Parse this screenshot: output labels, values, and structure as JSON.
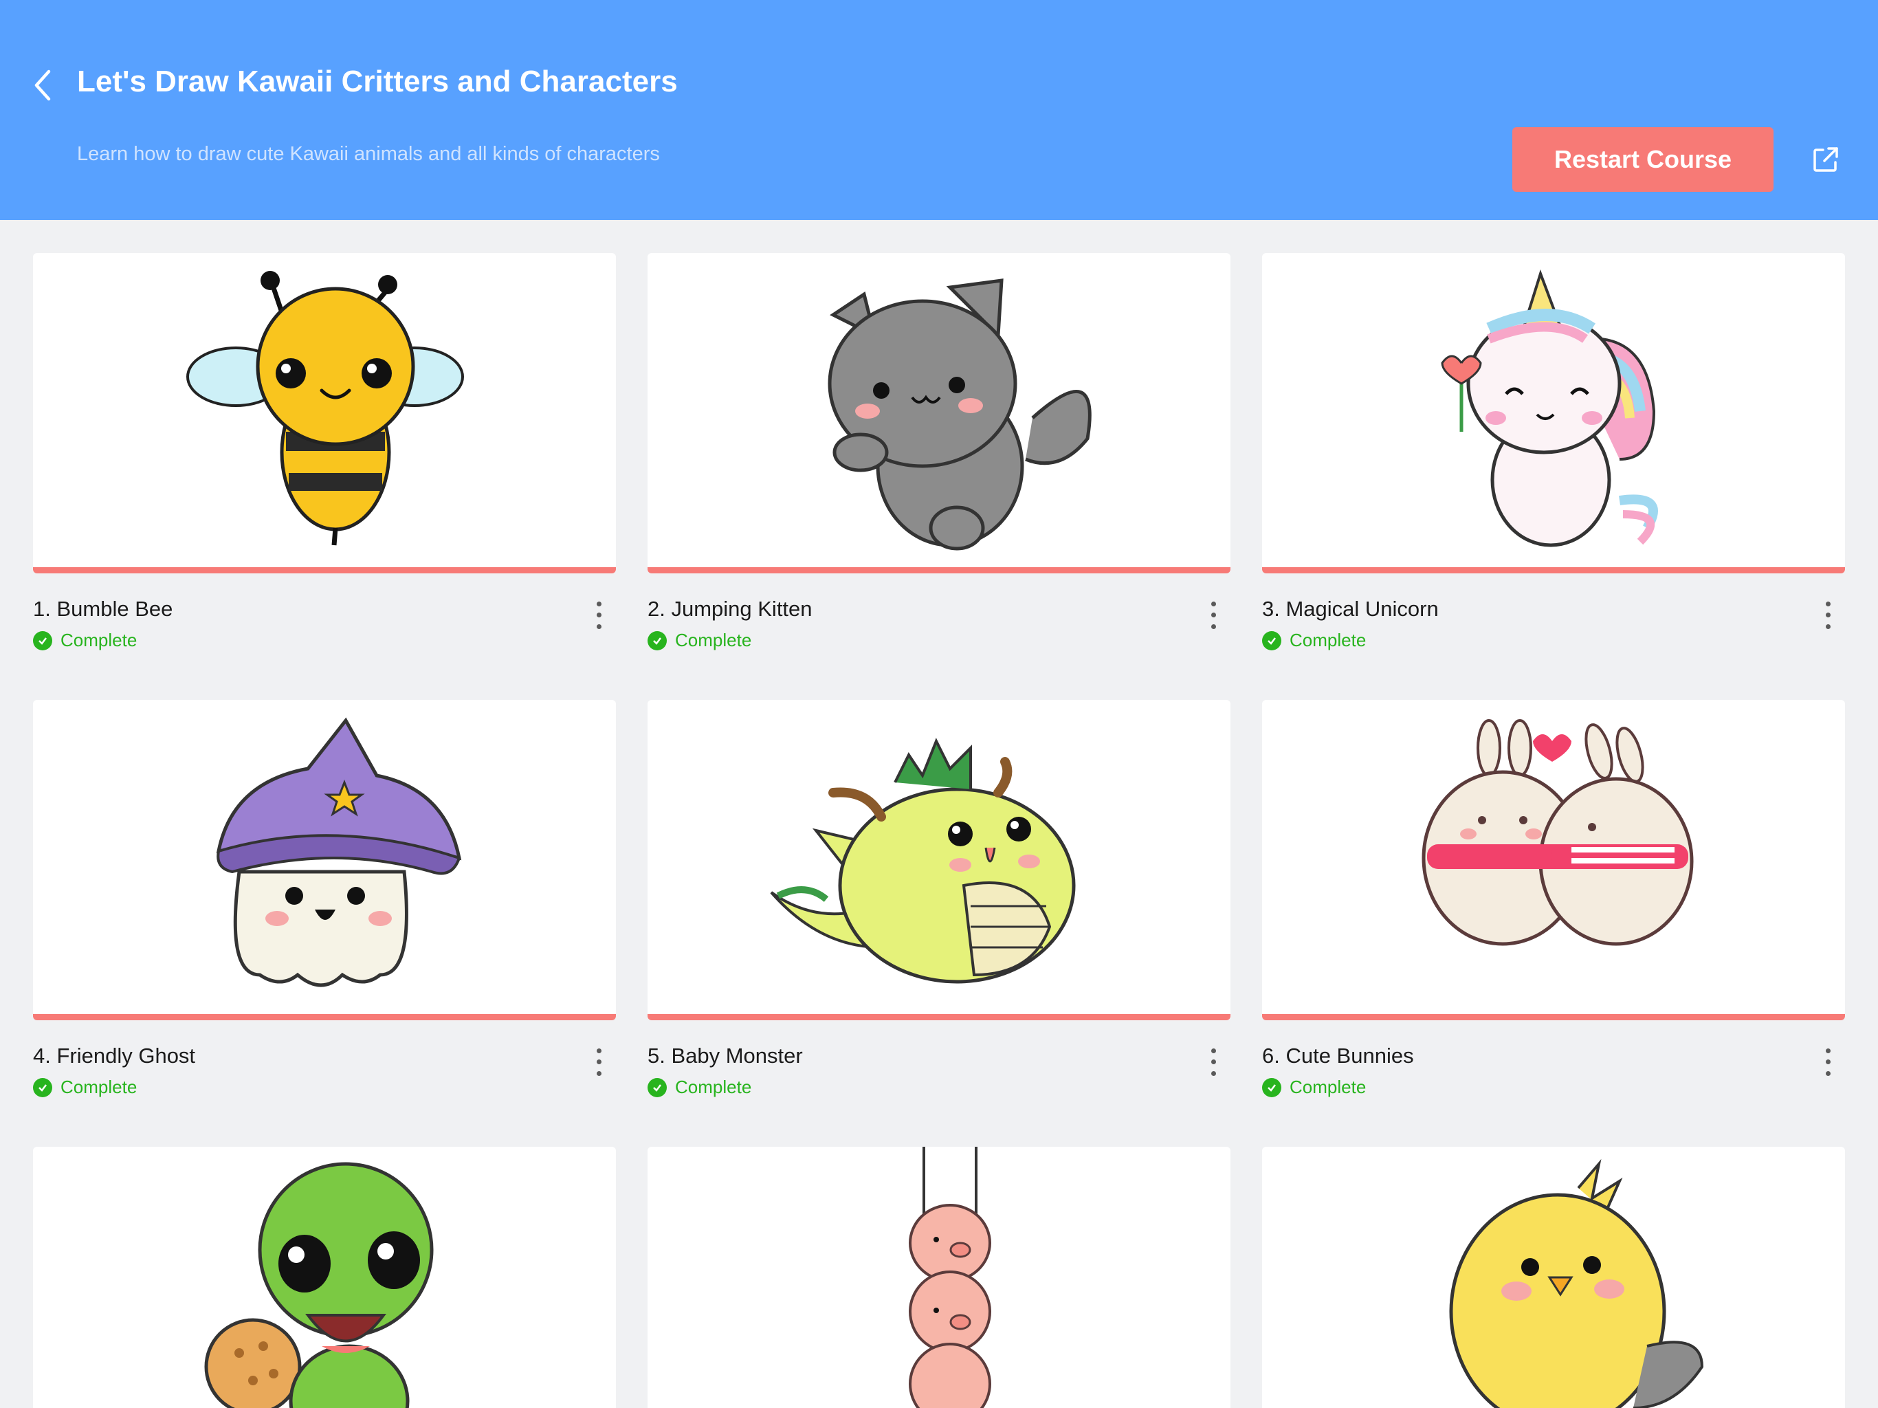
{
  "header": {
    "title": "Let's Draw Kawaii Critters and Characters",
    "subtitle": "Learn how to draw cute Kawaii animals and all kinds of characters",
    "restart_label": "Restart Course",
    "back_icon": "chevron-left-icon",
    "share_icon": "external-link-icon",
    "bg_color": "#58a1ff",
    "accent_color": "#f77a76"
  },
  "lessons": [
    {
      "title": "1. Bumble Bee",
      "status": "Complete",
      "progress": 1.0
    },
    {
      "title": "2. Jumping Kitten",
      "status": "Complete",
      "progress": 1.0
    },
    {
      "title": "3. Magical Unicorn",
      "status": "Complete",
      "progress": 1.0
    },
    {
      "title": "4. Friendly Ghost",
      "status": "Complete",
      "progress": 1.0
    },
    {
      "title": "5. Baby Monster",
      "status": "Complete",
      "progress": 1.0
    },
    {
      "title": "6. Cute Bunnies",
      "status": "Complete",
      "progress": 1.0
    },
    {
      "title": "",
      "status": "",
      "progress": 0
    },
    {
      "title": "",
      "status": "",
      "progress": 0
    },
    {
      "title": "",
      "status": "",
      "progress": 0
    }
  ],
  "status_color": "#28b41e"
}
